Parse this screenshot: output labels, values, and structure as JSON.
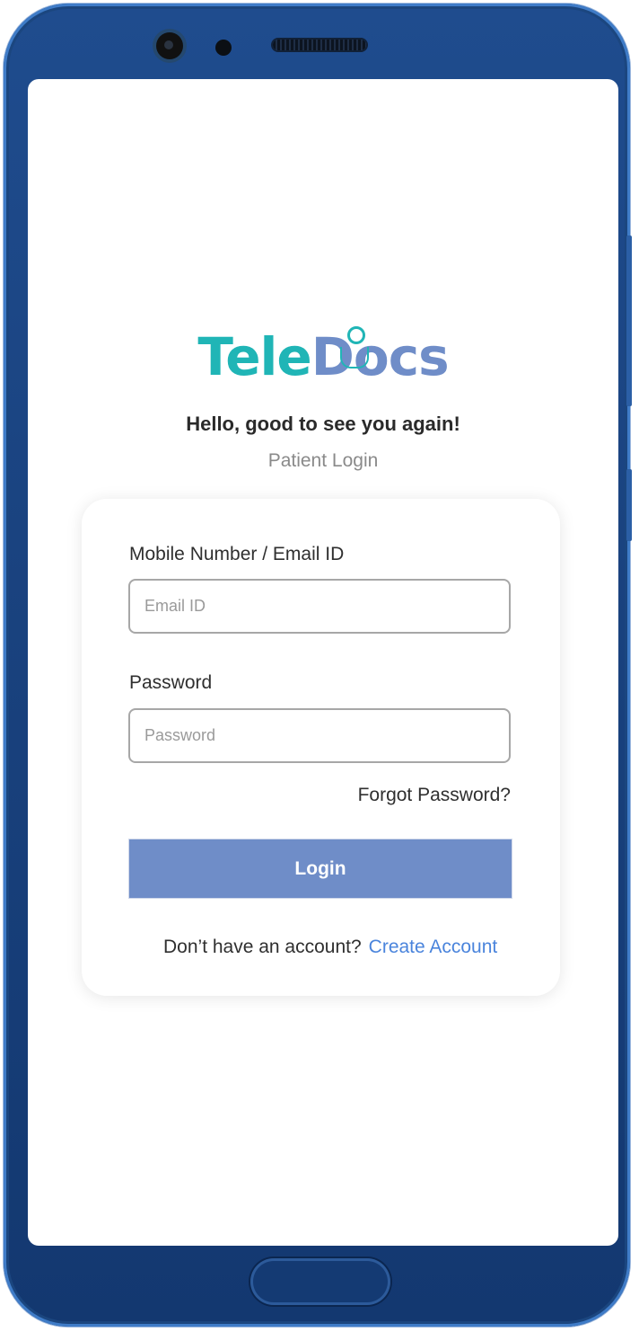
{
  "app": {
    "logo_part1": "Tele",
    "logo_part2": "Docs",
    "greeting": "Hello, good to see you again!",
    "subtitle": "Patient Login"
  },
  "form": {
    "email_label": "Mobile Number / Email ID",
    "email_placeholder": "Email ID",
    "email_value": "",
    "password_label": "Password",
    "password_placeholder": "Password",
    "password_value": "",
    "forgot_link": "Forgot Password?",
    "login_button": "Login",
    "no_account_text": "Don’t have an account?",
    "create_account_link": "Create Account"
  },
  "colors": {
    "brand_teal": "#20b5b6",
    "brand_blue": "#6f8dc8",
    "link_blue": "#4a84dc",
    "device_frame": "#1f4c8e"
  },
  "icons": [
    "camera-icon",
    "stethoscope-icon"
  ]
}
